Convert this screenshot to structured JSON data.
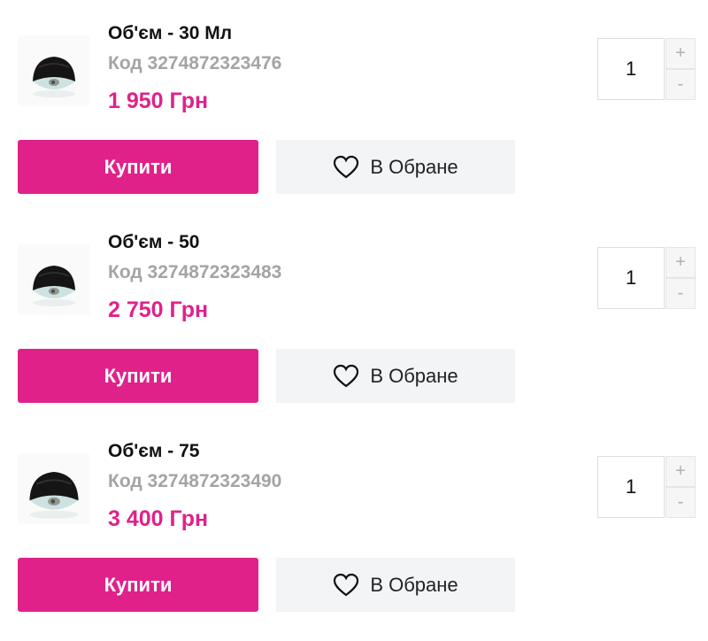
{
  "colors": {
    "accent": "#e0218a",
    "muted_text": "#a4a4a4",
    "favorite_bg": "#f3f4f6"
  },
  "variants": [
    {
      "title": "Об'єм - 30 Мл",
      "code": "Код 3274872323476",
      "price": "1 950 Грн",
      "quantity": "1",
      "plus": "+",
      "minus": "-",
      "buy_label": "Купити",
      "favorite_label": "В Обране",
      "favorite_icon": "heart-icon"
    },
    {
      "title": "Об'єм - 50",
      "code": "Код 3274872323483",
      "price": "2 750 Грн",
      "quantity": "1",
      "plus": "+",
      "minus": "-",
      "buy_label": "Купити",
      "favorite_label": "В Обране",
      "favorite_icon": "heart-icon"
    },
    {
      "title": "Об'єм - 75",
      "code": "Код 3274872323490",
      "price": "3 400 Грн",
      "quantity": "1",
      "plus": "+",
      "minus": "-",
      "buy_label": "Купити",
      "favorite_label": "В Обране",
      "favorite_icon": "heart-icon"
    }
  ]
}
